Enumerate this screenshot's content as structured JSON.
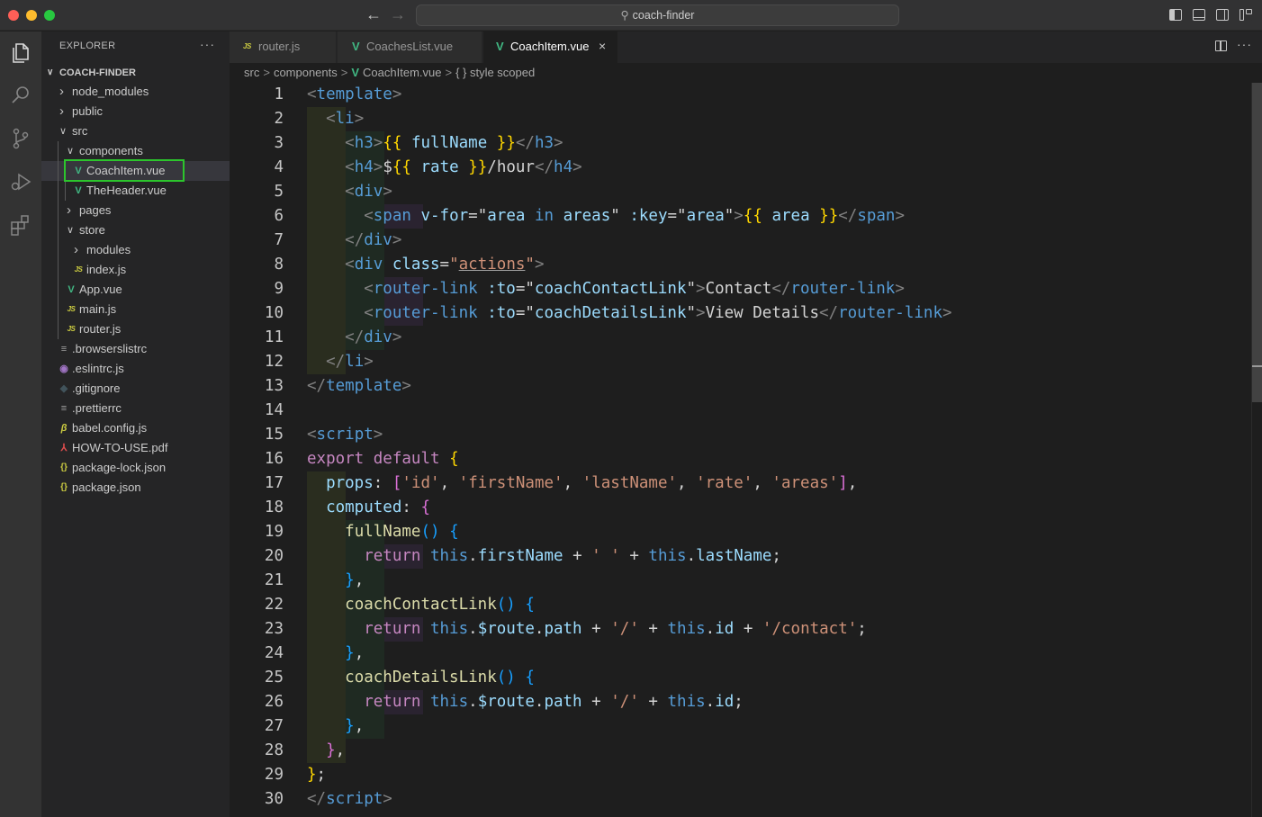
{
  "window": {
    "search_text": "coach-finder",
    "nav_back": "←",
    "nav_forward": "→"
  },
  "sidebar": {
    "title": "EXPLORER",
    "more": "···",
    "section": "COACH-FINDER",
    "items": [
      {
        "name": "node_modules",
        "kind": "folder",
        "expanded": false
      },
      {
        "name": "public",
        "kind": "folder",
        "expanded": false
      },
      {
        "name": "src",
        "kind": "folder",
        "expanded": true
      },
      {
        "name": "components",
        "kind": "folder",
        "expanded": true
      },
      {
        "name": "CoachItem.vue",
        "kind": "vue",
        "selected": true
      },
      {
        "name": "TheHeader.vue",
        "kind": "vue"
      },
      {
        "name": "pages",
        "kind": "folder",
        "expanded": false
      },
      {
        "name": "store",
        "kind": "folder",
        "expanded": true
      },
      {
        "name": "modules",
        "kind": "folder",
        "expanded": false
      },
      {
        "name": "index.js",
        "kind": "js"
      },
      {
        "name": "App.vue",
        "kind": "vue"
      },
      {
        "name": "main.js",
        "kind": "js"
      },
      {
        "name": "router.js",
        "kind": "js"
      },
      {
        "name": ".browserslistrc",
        "kind": "lines"
      },
      {
        "name": ".eslintrc.js",
        "kind": "eslint"
      },
      {
        "name": ".gitignore",
        "kind": "git"
      },
      {
        "name": ".prettierrc",
        "kind": "lines"
      },
      {
        "name": "babel.config.js",
        "kind": "babel"
      },
      {
        "name": "HOW-TO-USE.pdf",
        "kind": "pdf"
      },
      {
        "name": "package-lock.json",
        "kind": "json"
      },
      {
        "name": "package.json",
        "kind": "json"
      }
    ]
  },
  "tabs": [
    {
      "label": "router.js",
      "icon": "JS",
      "active": false
    },
    {
      "label": "CoachesList.vue",
      "icon": "V",
      "active": false
    },
    {
      "label": "CoachItem.vue",
      "icon": "V",
      "active": true,
      "close": "×"
    }
  ],
  "breadcrumb": {
    "parts": [
      "src",
      "components",
      "CoachItem.vue",
      "{ } style scoped"
    ],
    "sep": ">"
  },
  "editor": {
    "line_numbers": [
      "1",
      "2",
      "3",
      "4",
      "5",
      "6",
      "7",
      "8",
      "9",
      "10",
      "11",
      "12",
      "13",
      "14",
      "15",
      "16",
      "17",
      "18",
      "19",
      "20",
      "21",
      "22",
      "23",
      "24",
      "25",
      "26",
      "27",
      "28",
      "29",
      "30"
    ]
  },
  "icons": {
    "activity": [
      "files-icon",
      "search-icon",
      "source-control-icon",
      "run-debug-icon",
      "extensions-icon"
    ]
  },
  "colors": {
    "selection_highlight": "#2cc52c",
    "vue": "#41b883"
  }
}
